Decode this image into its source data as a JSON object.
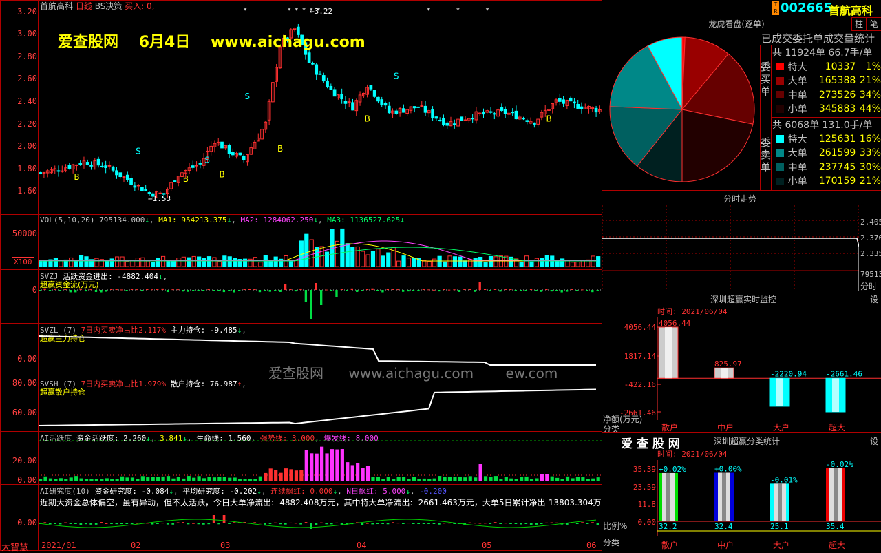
{
  "header": {
    "stock_name": "首航高科",
    "period": "日线",
    "indicator": "BS决策",
    "signal": "买入: 0,"
  },
  "watermark": {
    "site": "爱查股网",
    "date": "6月4日",
    "url": "www.aichagu.com",
    "mid_site": "爱查股网",
    "mid_url": "www.aichagu.com",
    "mid_tail": "ew.com"
  },
  "price_axis": [
    "3.20",
    "3.00",
    "2.80",
    "2.60",
    "2.40",
    "2.20",
    "2.00",
    "1.80",
    "1.60"
  ],
  "price_marks": {
    "high": "3.22",
    "low": "1.53"
  },
  "vol_panel": {
    "label": "VOL(5,10,20)",
    "val": "795134.000",
    "ma1": "MA1: 954213.375",
    "ma2": "MA2: 1284062.250",
    "ma3": "MA3: 1136527.625",
    "axis": "50000",
    "unit": "X100"
  },
  "svzj_panel": {
    "label": "SVZJ",
    "title": "活跃资金进出: -4882.404",
    "sub": "超赢资金流(万元)",
    "axis": "0"
  },
  "svzl_panel": {
    "label": "SVZL (7)",
    "t1": "7日内买卖净占比2.117%",
    "t2": "主力持仓: -9.485",
    "sub": "超赢主力持仓",
    "axis": "0.00"
  },
  "svsh_panel": {
    "label": "SVSH (7)",
    "t1": "7日内买卖净占比1.979%",
    "t2": "散户持仓: 76.987",
    "sub": "超赢散户持仓",
    "axis1": "80.00",
    "axis2": "60.00"
  },
  "ai_panel": {
    "label": "AI活跃度",
    "t1": "资金活跃度: 2.260",
    "t2": "3.841",
    "t3": "生命线: 1.560",
    "t4": "强势线: 3.000",
    "t5": "爆发线: 8.000",
    "axis1": "20.00",
    "axis2": "0.00"
  },
  "ai_research": {
    "label": "AI研究度(10)",
    "t1": "资金研究度: -0.084",
    "t2": "平均研究度: -0.202",
    "t3": "连续飘红: 0.000",
    "t4": "N日飘红: 5.000",
    "t5": "-0.200",
    "comment": "近期大资金总体偏空，虽有异动，但不太活跃，今日大单净流出: -4882.408万元，其中特大单净流出: -2661.463万元，大单5日累计净出-13803.304万元，",
    "axis": "0.00"
  },
  "bottom_label": "大智慧",
  "date_axis": [
    "2021/01",
    "02",
    "03",
    "04",
    "05",
    "06"
  ],
  "code_box": {
    "code": "002665",
    "name": "首航高科",
    "badge": "T R"
  },
  "tabs": [
    "柱",
    "笔"
  ],
  "pie": {
    "title": "龙虎看盘(逐单)",
    "subtitle": "已成交委托单成交量统计"
  },
  "buy": {
    "side_label": "委买单",
    "total": "共 11924单 66.7手/单",
    "rows": [
      {
        "name": "特大",
        "value": "10337",
        "pct": "1%",
        "color": "#ff0000"
      },
      {
        "name": "大单",
        "value": "165388",
        "pct": "21%",
        "color": "#990000"
      },
      {
        "name": "中单",
        "value": "273526",
        "pct": "34%",
        "color": "#660000"
      },
      {
        "name": "小单",
        "value": "345883",
        "pct": "44%",
        "color": "#220000"
      }
    ]
  },
  "sell": {
    "side_label": "委卖单",
    "total": "共 6068单 131.0手/单",
    "rows": [
      {
        "name": "特大",
        "value": "125631",
        "pct": "16%",
        "color": "#00ffff"
      },
      {
        "name": "大单",
        "value": "261599",
        "pct": "33%",
        "color": "#008888"
      },
      {
        "name": "中单",
        "value": "237745",
        "pct": "30%",
        "color": "#006060"
      },
      {
        "name": "小单",
        "value": "170159",
        "pct": "21%",
        "color": "#002020"
      }
    ]
  },
  "intraday": {
    "title": "分时走势",
    "p1": "2.405",
    "p2": "2.370",
    "p3": "2.335",
    "vol": "79513",
    "vol_label": "分时"
  },
  "monitor": {
    "title": "深圳超赢实时监控",
    "time": "时间: 2021/06/04",
    "set": "设",
    "axis": [
      "4056.44",
      "1817.14",
      "-422.16",
      "-2661.46"
    ],
    "axis_label": "净额(万元)",
    "bars": [
      {
        "cat": "散户",
        "value": 4056.44,
        "label": "4056.44"
      },
      {
        "cat": "中户",
        "value": 825.97,
        "label": "825.97"
      },
      {
        "cat": "大户",
        "value": -2220.94,
        "label": "-2220.94"
      },
      {
        "cat": "超大",
        "value": -2661.46,
        "label": "-2661.46"
      }
    ],
    "cat_label": "分类"
  },
  "classify": {
    "brand": "爱 查 股 网",
    "title": "深圳超赢分类统计",
    "time": "时间: 2021/06/04",
    "set": "设",
    "axis": [
      "35.39",
      "23.59",
      "11.8",
      "0.00"
    ],
    "axis_label": "比例%",
    "cat_label": "分类",
    "bars": [
      {
        "cat": "散户",
        "value": 32.2,
        "label": "32.2",
        "top": "+0.02%",
        "color": "#00dd00"
      },
      {
        "cat": "中户",
        "value": 32.4,
        "label": "32.4",
        "top": "+0.00%",
        "color": "#0000dd"
      },
      {
        "cat": "大户",
        "value": 25.1,
        "label": "25.1",
        "top": "-0.01%",
        "color": "#00ffff"
      },
      {
        "cat": "超大",
        "value": 35.4,
        "label": "35.4",
        "top": "-0.02%",
        "color": "#ee0000"
      }
    ]
  }
}
